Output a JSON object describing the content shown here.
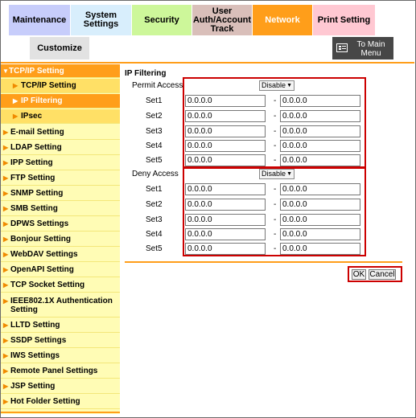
{
  "tabs": {
    "maintenance": "Maintenance",
    "system_settings": "System Settings",
    "security": "Security",
    "user_auth": "User Auth/Account Track",
    "network": "Network",
    "print_setting": "Print Setting",
    "customize": "Customize",
    "to_main_menu": "To Main Menu"
  },
  "sidebar": {
    "items": [
      {
        "label": "TCP/IP Setting"
      },
      {
        "label": "TCP/IP Setting"
      },
      {
        "label": "IP Filtering"
      },
      {
        "label": "IPsec"
      },
      {
        "label": "E-mail Setting"
      },
      {
        "label": "LDAP Setting"
      },
      {
        "label": "IPP Setting"
      },
      {
        "label": "FTP Setting"
      },
      {
        "label": "SNMP Setting"
      },
      {
        "label": "SMB Setting"
      },
      {
        "label": "DPWS Settings"
      },
      {
        "label": "Bonjour Setting"
      },
      {
        "label": "WebDAV Settings"
      },
      {
        "label": "OpenAPI Setting"
      },
      {
        "label": "TCP Socket Setting"
      },
      {
        "label": "IEEE802.1X Authentication Setting"
      },
      {
        "label": "LLTD Setting"
      },
      {
        "label": "SSDP Settings"
      },
      {
        "label": "IWS Settings"
      },
      {
        "label": "Remote Panel Settings"
      },
      {
        "label": "JSP Setting"
      },
      {
        "label": "Hot Folder Setting"
      }
    ]
  },
  "main": {
    "title": "IP Filtering",
    "permit": {
      "label": "Permit Access",
      "mode": "Disable",
      "sets": [
        {
          "label": "Set1",
          "from": "0.0.0.0",
          "to": "0.0.0.0"
        },
        {
          "label": "Set2",
          "from": "0.0.0.0",
          "to": "0.0.0.0"
        },
        {
          "label": "Set3",
          "from": "0.0.0.0",
          "to": "0.0.0.0"
        },
        {
          "label": "Set4",
          "from": "0.0.0.0",
          "to": "0.0.0.0"
        },
        {
          "label": "Set5",
          "from": "0.0.0.0",
          "to": "0.0.0.0"
        }
      ]
    },
    "deny": {
      "label": "Deny Access",
      "mode": "Disable",
      "sets": [
        {
          "label": "Set1",
          "from": "0.0.0.0",
          "to": "0.0.0.0"
        },
        {
          "label": "Set2",
          "from": "0.0.0.0",
          "to": "0.0.0.0"
        },
        {
          "label": "Set3",
          "from": "0.0.0.0",
          "to": "0.0.0.0"
        },
        {
          "label": "Set4",
          "from": "0.0.0.0",
          "to": "0.0.0.0"
        },
        {
          "label": "Set5",
          "from": "0.0.0.0",
          "to": "0.0.0.0"
        }
      ]
    },
    "separator": "-",
    "ok_label": "OK",
    "cancel_label": "Cancel"
  },
  "colors": {
    "maintenance_tab": "#c7cdfb",
    "system_tab": "#d8eefc",
    "security_tab": "#cdf79a",
    "user_auth_tab": "#d9bfba",
    "network_tab": "#ff9e1a",
    "print_tab": "#ffc8d2",
    "sidebar": "#fffcb5",
    "sidebar_active": "#ff9e1a",
    "sidebar_sub": "#ffe066",
    "highlight_box": "#cc0000"
  }
}
